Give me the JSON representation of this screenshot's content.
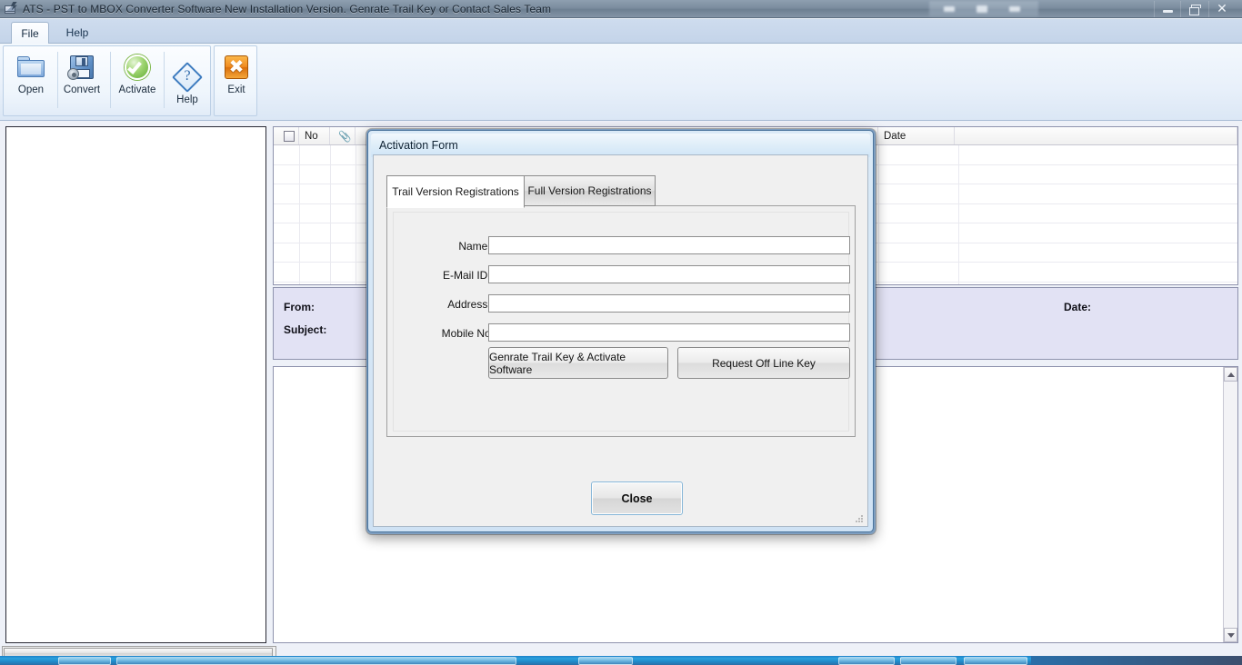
{
  "window": {
    "title": "ATS - PST to MBOX Converter Software New Installation Version. Genrate Trail Key or Contact Sales Team",
    "icon": "app-envelope-icon",
    "controls": {
      "minimize": "–",
      "restore": "❐",
      "close": "✕"
    }
  },
  "ribbon": {
    "tabs": [
      {
        "label": "File",
        "active": true
      },
      {
        "label": "Help",
        "active": false
      }
    ],
    "buttons": [
      {
        "label": "Open",
        "icon": "folder-open-icon"
      },
      {
        "label": "Convert",
        "icon": "floppy-gear-icon"
      },
      {
        "label": "Activate",
        "icon": "green-check-circle-icon"
      },
      {
        "label": "Help",
        "icon": "blue-diamond-question-icon"
      },
      {
        "label": "Exit",
        "icon": "orange-x-icon"
      }
    ]
  },
  "grid": {
    "columns": [
      {
        "label": "",
        "icon": "checkbox-icon"
      },
      {
        "label": "No"
      },
      {
        "label": "",
        "icon": "paperclip-icon"
      },
      {
        "label": ""
      },
      {
        "label": "Date"
      },
      {
        "label": ""
      }
    ],
    "rows": []
  },
  "header_panel": {
    "from_label": "From:",
    "subject_label": "Subject:",
    "date_label": "Date:",
    "from_value": "",
    "subject_value": "",
    "date_value": "",
    "background": "#e2e2f4"
  },
  "dialog": {
    "title": "Activation Form",
    "tabs": [
      {
        "label": "Trail Version Registrations",
        "active": true
      },
      {
        "label": "Full Version Registrations",
        "active": false
      }
    ],
    "fields": [
      {
        "label": "Name :",
        "value": "",
        "placeholder": ""
      },
      {
        "label": "E-Mail ID :",
        "value": "",
        "placeholder": ""
      },
      {
        "label": "Address :",
        "value": "",
        "placeholder": ""
      },
      {
        "label": "Mobile No:",
        "value": "",
        "placeholder": ""
      }
    ],
    "actions": {
      "generate": "Genrate Trail Key & Activate Software",
      "offline": "Request Off Line Key"
    },
    "close_label": "Close"
  },
  "colors": {
    "titlebar": "#7c8d9f",
    "ribbon": "#e8f0fa",
    "dialog_title": "#cfe5f7",
    "header_panel": "#e2e2f4",
    "accent_focus": "#86b6d8",
    "activate_green": "#63ad36",
    "exit_orange": "#f08b20"
  }
}
